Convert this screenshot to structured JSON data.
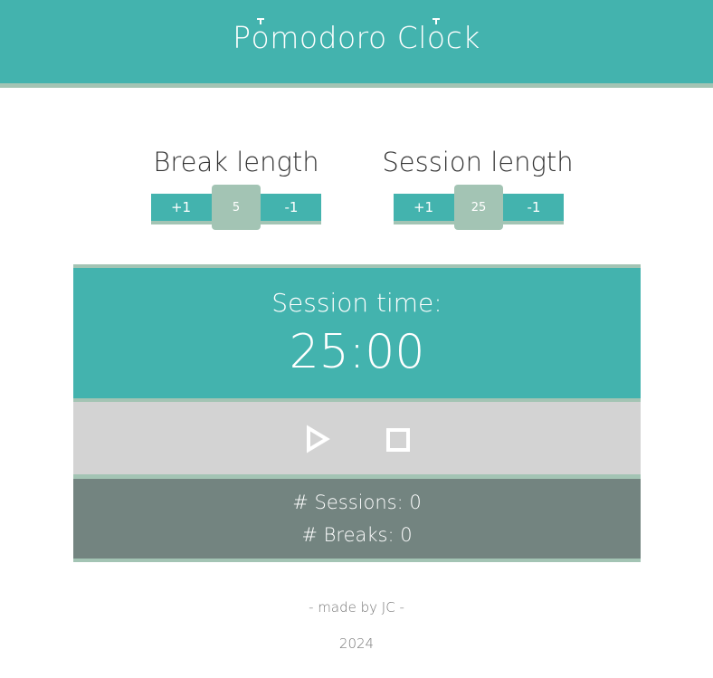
{
  "header": {
    "title_parts": [
      "P",
      "o",
      "modoro Cl",
      "o",
      "ck"
    ]
  },
  "break": {
    "label": "Break length",
    "plus_label": "+1",
    "value": "5",
    "minus_label": "-1"
  },
  "session": {
    "label": "Session length",
    "plus_label": "+1",
    "value": "25",
    "minus_label": "-1"
  },
  "timer": {
    "label": "Session time:",
    "value": "25:00",
    "play_icon": "play-icon",
    "stop_icon": "stop-icon"
  },
  "stats": {
    "sessions": "# Sessions: 0",
    "breaks": "# Breaks: 0"
  },
  "footer": {
    "credit": "- made by JC -",
    "year": "2024"
  },
  "colors": {
    "teal": "#43b3ae",
    "sage": "#a3c4b4",
    "grey": "#d3d3d3",
    "slate": "#738480"
  }
}
